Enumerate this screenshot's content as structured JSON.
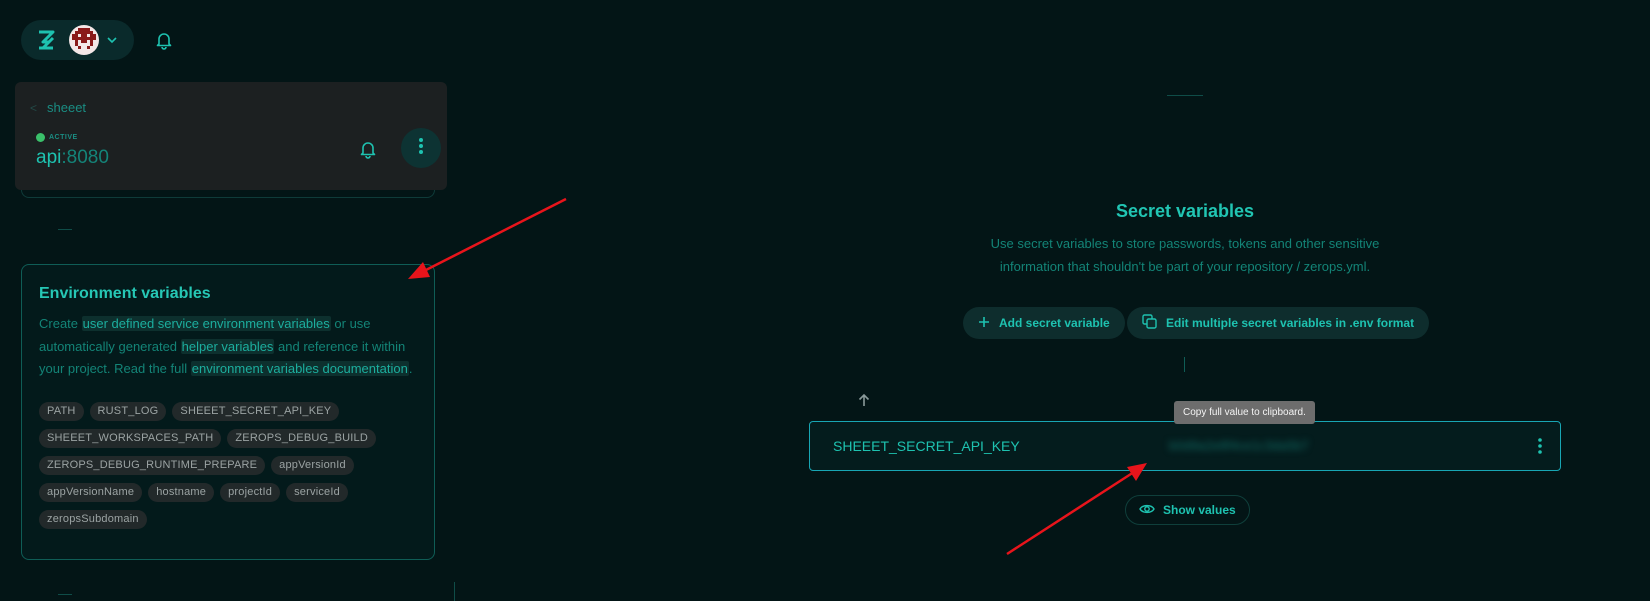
{
  "header": {
    "logo_icon": "zerops-logo-icon",
    "avatar_icon": "avatar-icon",
    "notifications_icon": "bell-icon"
  },
  "service": {
    "breadcrumb": "sheeet",
    "status": "ACTIVE",
    "hostname": "api",
    "port": ":8080"
  },
  "env_card": {
    "title": "Environment variables",
    "desc_parts": {
      "p1": "Create ",
      "link1": "user defined service environment variables",
      "p2": " or use automatically generated ",
      "link2": "helper variables",
      "p3": " and reference it within your project. Read the full ",
      "link3": "environment variables documentation",
      "p4": "."
    },
    "chips": [
      "PATH",
      "RUST_LOG",
      "SHEEET_SECRET_API_KEY",
      "SHEEET_WORKSPACES_PATH",
      "ZEROPS_DEBUG_BUILD",
      "ZEROPS_DEBUG_RUNTIME_PREPARE",
      "appVersionId",
      "appVersionName",
      "hostname",
      "projectId",
      "serviceId",
      "zeropsSubdomain"
    ]
  },
  "secrets": {
    "title": "Secret variables",
    "desc_line1": "Use secret variables to store passwords, tokens and other sensitive",
    "desc_line2": "information that shouldn't be part of your repository / zerops.yml.",
    "add_button": "Add secret variable",
    "edit_button": "Edit multiple secret variables in .env format",
    "tooltip": "Copy full value to clipboard.",
    "variable": {
      "key": "SHEEET_SECRET_API_KEY",
      "value": "b0d9a2e8f4ce1c3da5b7"
    },
    "show_values_button": "Show values"
  },
  "colors": {
    "background": "#031516",
    "accent": "#1ec2b0",
    "annotation_arrow": "#e8141b",
    "active_status": "#3ac06a"
  }
}
